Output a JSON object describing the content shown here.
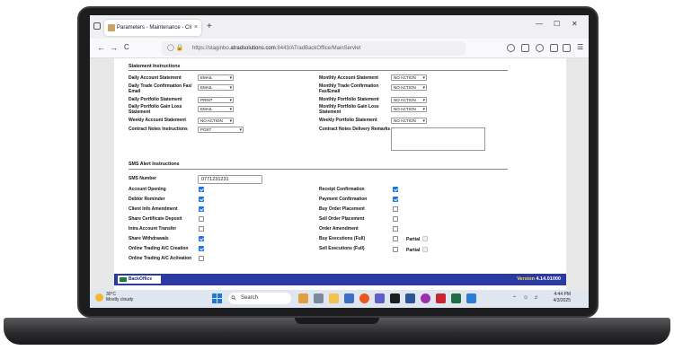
{
  "browser": {
    "tab_title": "Parameters - Maintenance - Cli",
    "tab_close": "×",
    "new_tab": "+",
    "url_prefix": "https://staginbo.",
    "url_domain": "atradsolutions.com",
    "url_rest": ":8443/ATradBackOffice/MainServlet",
    "back": "←",
    "forward": "→",
    "reload": "C",
    "win_min": "—",
    "win_max": "☐",
    "win_close": "✕"
  },
  "statement": {
    "title": "Statement Instructions",
    "left": [
      {
        "label": "Daily Account Statement",
        "value": "EMAIL"
      },
      {
        "label": "Daily Trade Confirmation Fax/ Email",
        "value": "EMAIL"
      },
      {
        "label": "Daily Portfolio Statement",
        "value": "PRINT"
      },
      {
        "label": "Daily Portfolio Gain Loss Statement",
        "value": "EMAIL"
      },
      {
        "label": "Weekly Account Statement",
        "value": "NO ACTION"
      },
      {
        "label": "Contract Notes Instructions",
        "value": "POST"
      }
    ],
    "right": [
      {
        "label": "Monthly Account Statement",
        "value": "NO ACTION"
      },
      {
        "label": "Monthly Trade Confirmation Fax/Email",
        "value": "NO ACTION"
      },
      {
        "label": "Monthly Portfolio Statement",
        "value": "NO ACTION"
      },
      {
        "label": "Monthly Portfolio Gain Loss Statement",
        "value": "NO ACTION"
      },
      {
        "label": "Weekly Portfolio Statement",
        "value": "NO ACTION"
      },
      {
        "label": "Contract Notes Delivery Remarks",
        "value": ""
      }
    ]
  },
  "sms": {
    "title": "SMS Alert Instructions",
    "number_label": "SMS Number",
    "number_value": "0771231231",
    "left": [
      {
        "label": "Account Opening",
        "checked": true
      },
      {
        "label": "Debtor Reminder",
        "checked": true
      },
      {
        "label": "Client Info Amendment",
        "checked": true
      },
      {
        "label": "Share Certificate Deposit",
        "checked": false
      },
      {
        "label": "Intra Account Transfer",
        "checked": false
      },
      {
        "label": "Share Withdrawals",
        "checked": true
      },
      {
        "label": "Online Trading A/C Creation",
        "checked": true
      },
      {
        "label": "Online Trading A/C Activation",
        "checked": false
      }
    ],
    "right": [
      {
        "label": "Receipt Confirmation",
        "checked": true
      },
      {
        "label": "Payment Confirmation",
        "checked": true
      },
      {
        "label": "Buy Order Placement",
        "checked": false
      },
      {
        "label": "Sell Order Placement",
        "checked": false
      },
      {
        "label": "Order Amendment",
        "checked": false
      },
      {
        "label": "Buy Executions (Full)",
        "checked": false,
        "partial_label": "Partial"
      },
      {
        "label": "Sell Executions (Full)",
        "checked": false,
        "partial_label": "Partial"
      }
    ]
  },
  "footer": {
    "logo": "BackOffice",
    "version_label": "Version",
    "version_number": "4.14.01000"
  },
  "taskbar": {
    "temp": "30°C",
    "weather": "Mostly cloudy",
    "search": "Search",
    "time": "4:44 PM",
    "date": "4/3/2025"
  },
  "colors": {
    "footer_bar": "#2b3aa3",
    "version_text": "#ffd84a",
    "checkbox_on": "#1a73e8"
  }
}
